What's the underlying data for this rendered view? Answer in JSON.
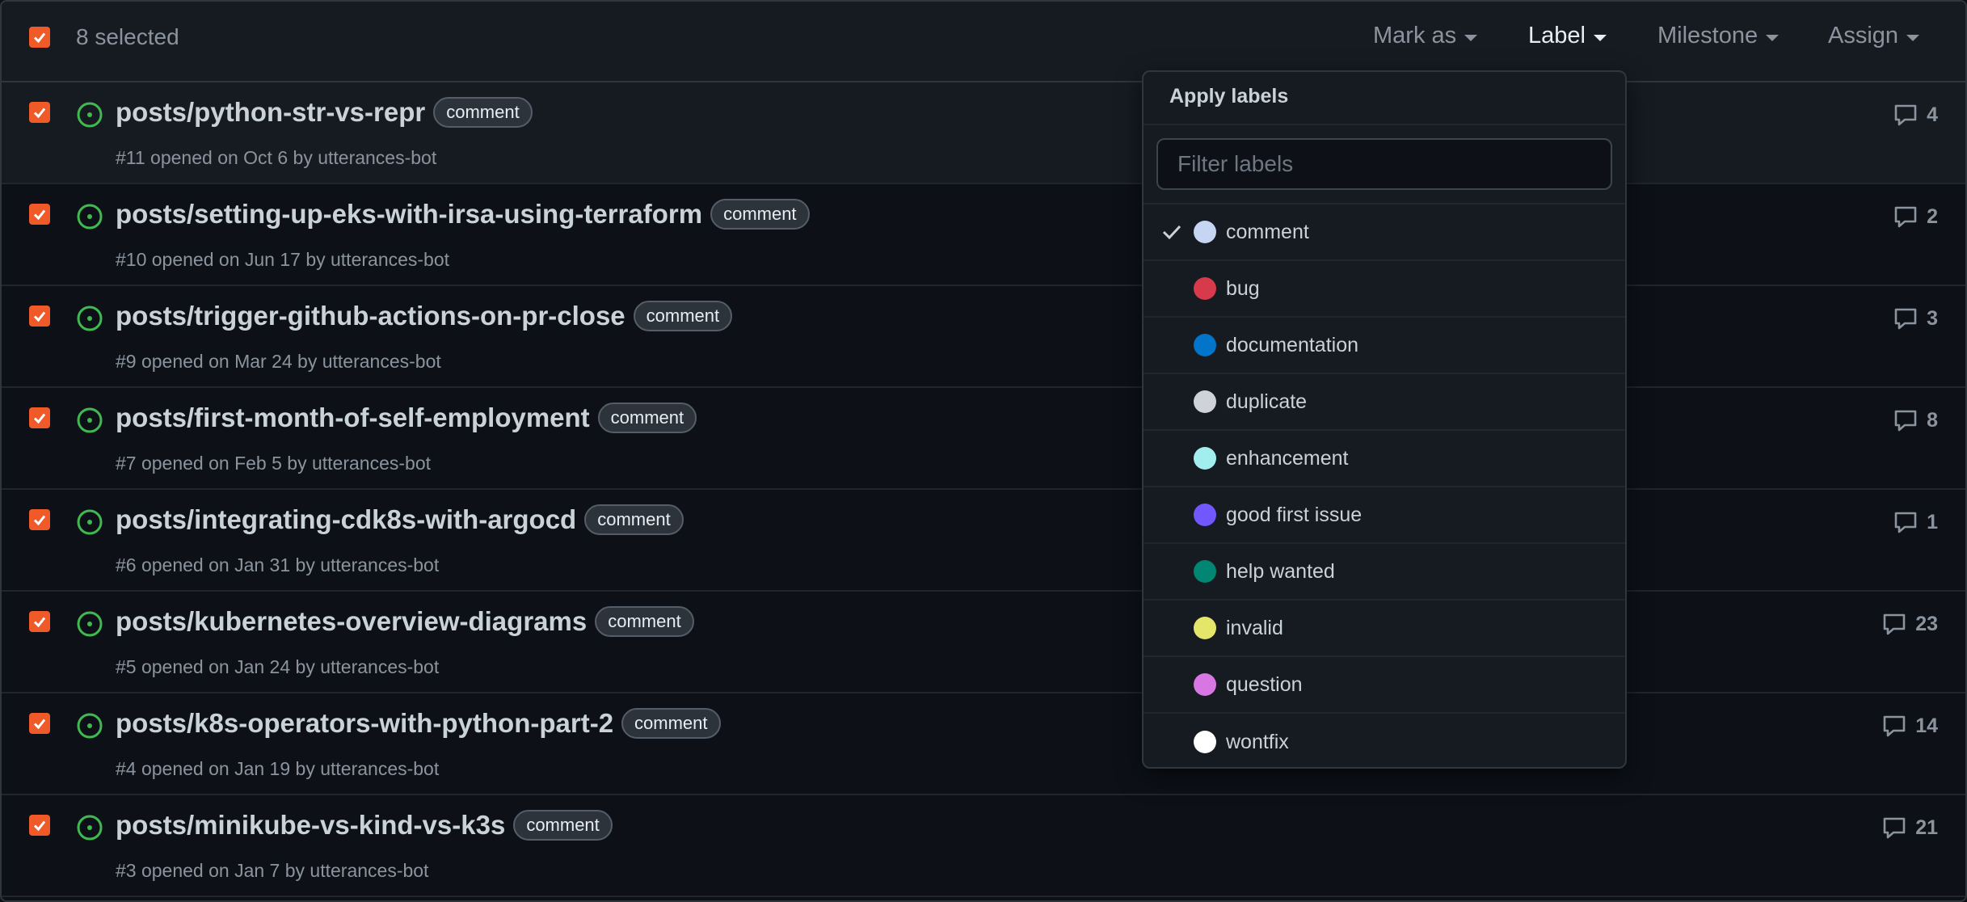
{
  "header": {
    "selected_text": "8 selected",
    "actions": [
      {
        "label": "Mark as",
        "active": false
      },
      {
        "label": "Label",
        "active": true
      },
      {
        "label": "Milestone",
        "active": false
      },
      {
        "label": "Assign",
        "active": false
      }
    ]
  },
  "issues": [
    {
      "title": "posts/python-str-vs-repr",
      "label": "comment",
      "meta": "#11 opened on Oct 6 by utterances-bot",
      "comments": "4"
    },
    {
      "title": "posts/setting-up-eks-with-irsa-using-terraform",
      "label": "comment",
      "meta": "#10 opened on Jun 17 by utterances-bot",
      "comments": "2"
    },
    {
      "title": "posts/trigger-github-actions-on-pr-close",
      "label": "comment",
      "meta": "#9 opened on Mar 24 by utterances-bot",
      "comments": "3"
    },
    {
      "title": "posts/first-month-of-self-employment",
      "label": "comment",
      "meta": "#7 opened on Feb 5 by utterances-bot",
      "comments": "8"
    },
    {
      "title": "posts/integrating-cdk8s-with-argocd",
      "label": "comment",
      "meta": "#6 opened on Jan 31 by utterances-bot",
      "comments": "1"
    },
    {
      "title": "posts/kubernetes-overview-diagrams",
      "label": "comment",
      "meta": "#5 opened on Jan 24 by utterances-bot",
      "comments": "23"
    },
    {
      "title": "posts/k8s-operators-with-python-part-2",
      "label": "comment",
      "meta": "#4 opened on Jan 19 by utterances-bot",
      "comments": "14"
    },
    {
      "title": "posts/minikube-vs-kind-vs-k3s",
      "label": "comment",
      "meta": "#3 opened on Jan 7 by utterances-bot",
      "comments": "21"
    }
  ],
  "label_menu": {
    "title": "Apply labels",
    "filter_placeholder": "Filter labels",
    "labels": [
      {
        "name": "comment",
        "color": "#c5d5f2",
        "checked": true
      },
      {
        "name": "bug",
        "color": "#d73a4a",
        "checked": false
      },
      {
        "name": "documentation",
        "color": "#0075ca",
        "checked": false
      },
      {
        "name": "duplicate",
        "color": "#cfd3d7",
        "checked": false
      },
      {
        "name": "enhancement",
        "color": "#a2eeef",
        "checked": false
      },
      {
        "name": "good first issue",
        "color": "#7057ff",
        "checked": false
      },
      {
        "name": "help wanted",
        "color": "#008672",
        "checked": false
      },
      {
        "name": "invalid",
        "color": "#e4e669",
        "checked": false
      },
      {
        "name": "question",
        "color": "#d876e3",
        "checked": false
      },
      {
        "name": "wontfix",
        "color": "#ffffff",
        "checked": false
      }
    ]
  },
  "colors": {
    "checkbox": "#f05a28",
    "open_issue": "#3fb950"
  }
}
